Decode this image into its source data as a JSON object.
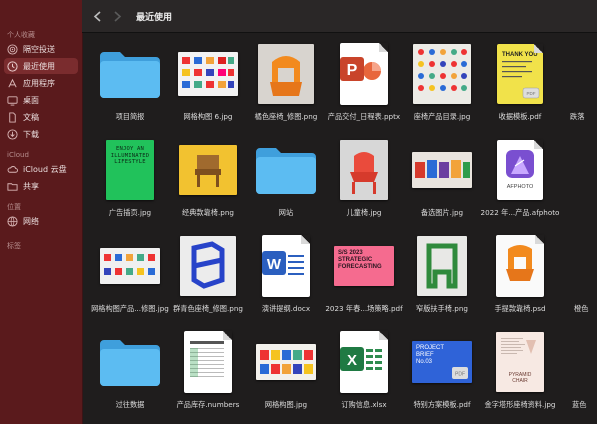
{
  "sidebar": {
    "sections": [
      {
        "title": "个人收藏",
        "items": [
          {
            "label": "隔空投送",
            "icon": "airdrop-icon"
          },
          {
            "label": "最近使用",
            "icon": "clock-icon",
            "active": true
          },
          {
            "label": "应用程序",
            "icon": "applications-icon"
          },
          {
            "label": "桌面",
            "icon": "desktop-icon"
          },
          {
            "label": "文稿",
            "icon": "document-icon"
          },
          {
            "label": "下载",
            "icon": "download-icon"
          }
        ]
      },
      {
        "title": "iCloud",
        "items": [
          {
            "label": "iCloud 云盘",
            "icon": "cloud-icon"
          },
          {
            "label": "共享",
            "icon": "shared-folder-icon"
          }
        ]
      },
      {
        "title": "位置",
        "items": [
          {
            "label": "网络",
            "icon": "network-icon"
          }
        ]
      },
      {
        "title": "标签",
        "items": []
      }
    ]
  },
  "toolbar": {
    "title": "最近使用"
  },
  "files": [
    {
      "name": "项目简报",
      "kind": "folder"
    },
    {
      "name": "网格构图 6.jpg",
      "kind": "grid-photo"
    },
    {
      "name": "橘色座椅_修图.png",
      "kind": "orange-chair"
    },
    {
      "name": "产品交付_日程表.pptx",
      "kind": "pptx"
    },
    {
      "name": "座椅产品目录.jpg",
      "kind": "catalog"
    },
    {
      "name": "收据模板.pdf",
      "kind": "receipt"
    },
    {
      "name": "跌落",
      "kind": "dark-photo"
    },
    {
      "name": "广告插页.jpg",
      "kind": "poster-green",
      "poster_text": "ENJOY AN ILLUMINATED LIFESTYLE"
    },
    {
      "name": "经典款靠椅.png",
      "kind": "yellow-chair"
    },
    {
      "name": "网站",
      "kind": "folder"
    },
    {
      "name": "儿童椅.jpg",
      "kind": "red-chair"
    },
    {
      "name": "备选图片.jpg",
      "kind": "chairs-row"
    },
    {
      "name": "2022 年...产品.afphoto",
      "kind": "afphoto",
      "app_label": "AFPHOTO"
    },
    {
      "name": "",
      "kind": "folder-partial"
    },
    {
      "name": "网格构图产品...修图.jpg",
      "kind": "grid-photo2"
    },
    {
      "name": "群青色座椅_修图.png",
      "kind": "blue-chair"
    },
    {
      "name": "演讲提纲.docx",
      "kind": "docx"
    },
    {
      "name": "2023 年春...场策略.pdf",
      "kind": "strategy-pdf",
      "poster_text": "S/S 2023 STRATEGIC FORECASTING"
    },
    {
      "name": "窄版扶手椅.png",
      "kind": "green-chair"
    },
    {
      "name": "手提款靠椅.psd",
      "kind": "orange-chair2"
    },
    {
      "name": "橙色",
      "kind": "partial-photo"
    },
    {
      "name": "过往数据",
      "kind": "folder"
    },
    {
      "name": "产品库存.numbers",
      "kind": "numbers"
    },
    {
      "name": "网格构图.jpg",
      "kind": "grid-photo3"
    },
    {
      "name": "订购信息.xlsx",
      "kind": "xlsx"
    },
    {
      "name": "特别方案模板.pdf",
      "kind": "project-brief",
      "poster_text": "PROJECT BRIEF No.03"
    },
    {
      "name": "金字塔形座椅资料.jpg",
      "kind": "pyramid",
      "poster_text": "PYRAMID CHAIR"
    },
    {
      "name": "蓝色",
      "kind": "partial-blue"
    }
  ],
  "colors": {
    "sidebar_bg": "#5a1a1c",
    "folder_blue": "#4fb1ea",
    "content_bg": "#1f1d1d"
  }
}
